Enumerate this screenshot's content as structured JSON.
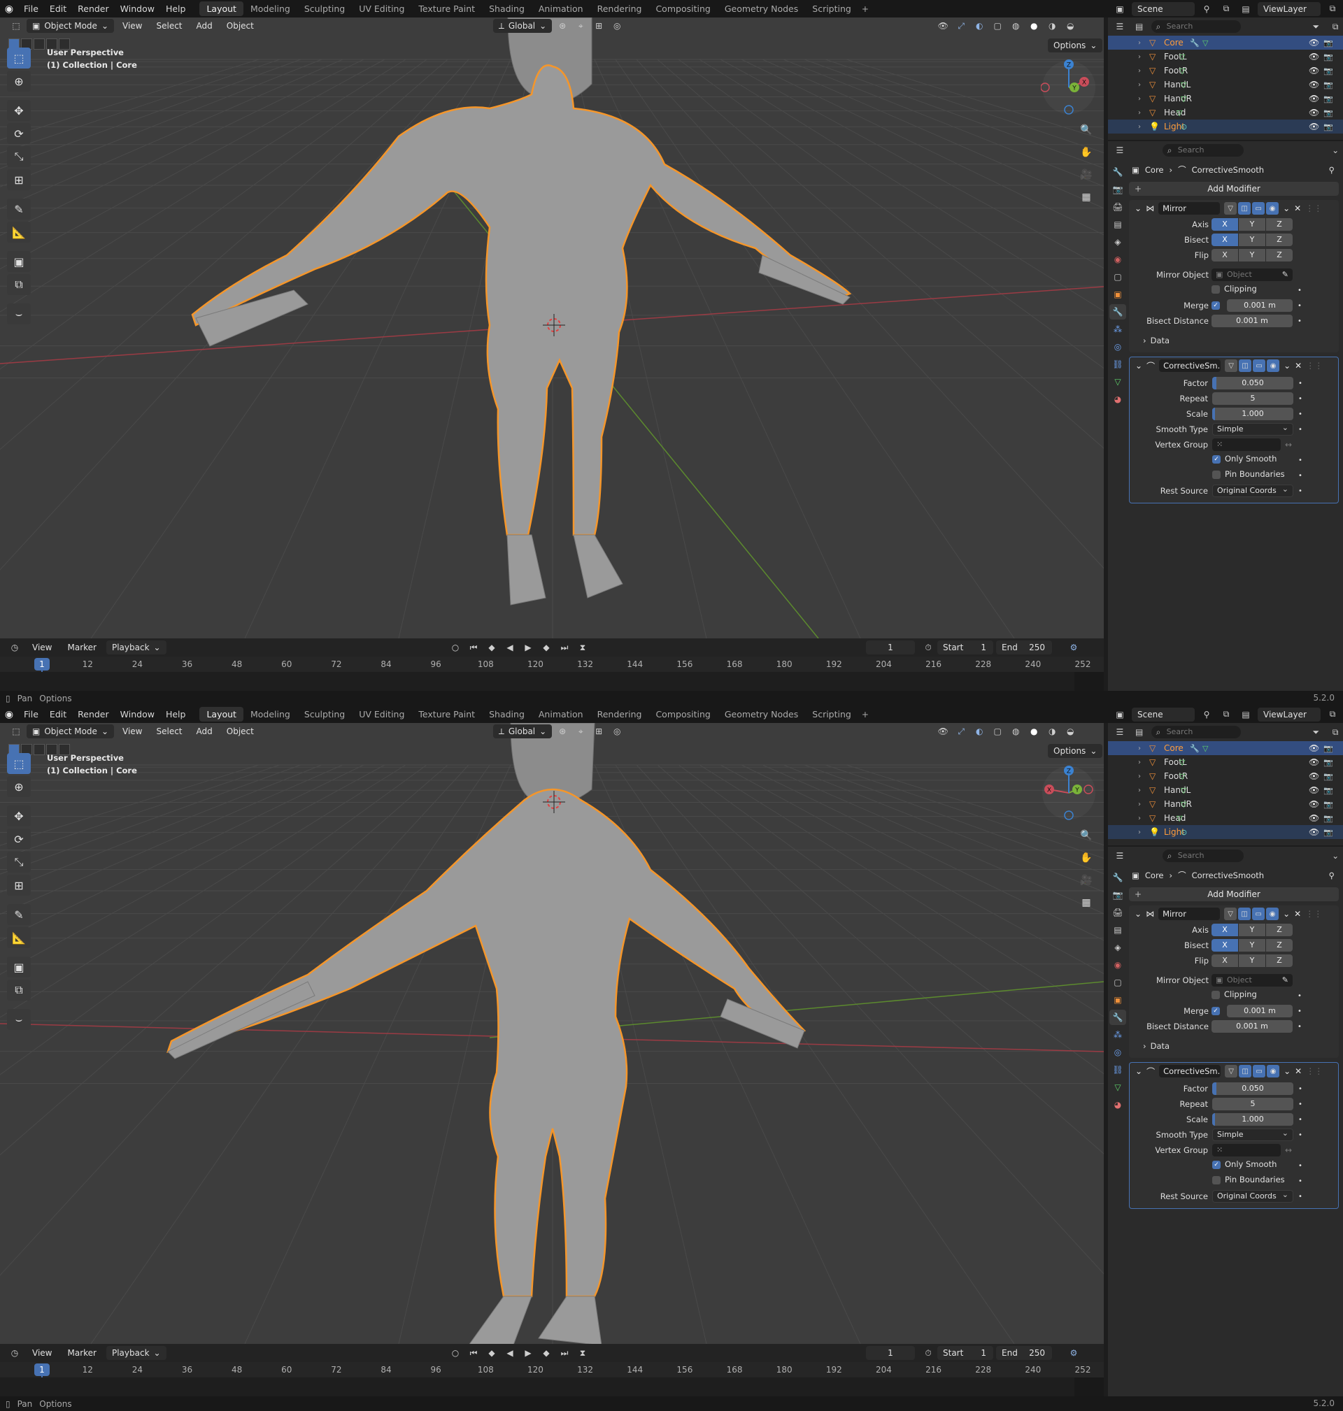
{
  "instances": [
    {
      "id": "a",
      "view": "front",
      "viewport_info": [
        "User Perspective",
        "(1) Collection | Core"
      ],
      "outliner_active": "Core"
    },
    {
      "id": "b",
      "view": "back",
      "viewport_info": [
        "User Perspective",
        "(1) Collection | Core"
      ],
      "outliner_active": "Core"
    }
  ],
  "topbar": {
    "menus": [
      "File",
      "Edit",
      "Render",
      "Window",
      "Help"
    ],
    "workspaces": [
      "Layout",
      "Modeling",
      "Sculpting",
      "UV Editing",
      "Texture Paint",
      "Shading",
      "Animation",
      "Rendering",
      "Compositing",
      "Geometry Nodes",
      "Scripting"
    ],
    "active_workspace": "Layout",
    "scene": "Scene",
    "view_layer": "ViewLayer"
  },
  "viewport_header": {
    "mode": "Object Mode",
    "menus": [
      "View",
      "Select",
      "Add",
      "Object"
    ],
    "transform_orientation": "Global",
    "options": "Options"
  },
  "viewport": {
    "line1": "User Perspective",
    "line2": "(1) Collection | Core",
    "gizmo_axes": [
      "X",
      "Y",
      "Z"
    ]
  },
  "timeline": {
    "menus": [
      "View",
      "Marker",
      "Playback"
    ],
    "current_frame": "1",
    "start_label": "Start",
    "start": "1",
    "end_label": "End",
    "end": "250",
    "ruler": [
      "12",
      "24",
      "36",
      "48",
      "60",
      "72",
      "84",
      "96",
      "108",
      "120",
      "132",
      "144",
      "156",
      "168",
      "180",
      "192",
      "204",
      "216",
      "228",
      "240",
      "252"
    ],
    "cursor": "1"
  },
  "statusbar": {
    "pan": "Pan",
    "options": "Options",
    "version": "5.2.0"
  },
  "outliner": {
    "search_placeholder": "Search",
    "items": [
      {
        "name": "Core",
        "selected": true
      },
      {
        "name": "FootL"
      },
      {
        "name": "FootR"
      },
      {
        "name": "HandL"
      },
      {
        "name": "HandR"
      },
      {
        "name": "Head"
      },
      {
        "name": "Light",
        "light": true
      }
    ]
  },
  "properties": {
    "search_placeholder": "Search",
    "breadcrumb_object": "Core",
    "breadcrumb_modifier": "CorrectiveSmooth",
    "add_modifier": "Add Modifier",
    "mirror": {
      "name": "Mirror",
      "axis_label": "Axis",
      "bisect_label": "Bisect",
      "flip_label": "Flip",
      "axes": [
        "X",
        "Y",
        "Z"
      ],
      "mirror_object_label": "Mirror Object",
      "mirror_object_placeholder": "Object",
      "clipping_label": "Clipping",
      "merge_label": "Merge",
      "merge_value": "0.001 m",
      "bisect_distance_label": "Bisect Distance",
      "bisect_distance_value": "0.001 m",
      "data_label": "Data"
    },
    "corrective": {
      "name": "CorrectiveSm...",
      "factor_label": "Factor",
      "factor_value": "0.050",
      "factor_fraction": 0.05,
      "repeat_label": "Repeat",
      "repeat_value": "5",
      "scale_label": "Scale",
      "scale_value": "1.000",
      "smooth_type_label": "Smooth Type",
      "smooth_type_value": "Simple",
      "vertex_group_label": "Vertex Group",
      "only_smooth_label": "Only Smooth",
      "pin_boundaries_label": "Pin Boundaries",
      "rest_source_label": "Rest Source",
      "rest_source_value": "Original Coords"
    }
  },
  "colors": {
    "accent": "#4772b3",
    "selection_outline": "#f5962a",
    "x_axis": "#c94d5a",
    "y_axis": "#7ab239",
    "z_axis": "#3b82d1"
  }
}
